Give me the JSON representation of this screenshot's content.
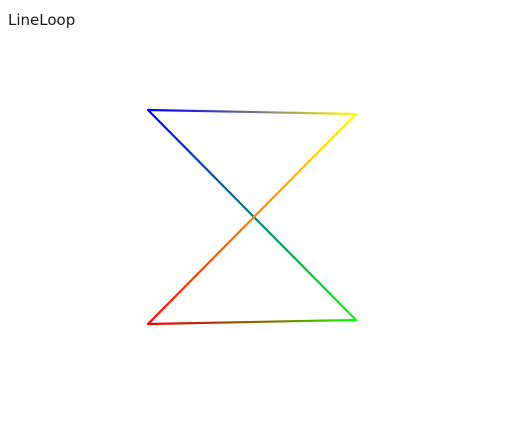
{
  "window": {
    "title": "LineLoop"
  },
  "colors": {
    "background": "#ffffff",
    "title_text": "#1a1a1a",
    "blue": "#0000ff",
    "yellow": "#ffff00",
    "green": "#00ff00",
    "red": "#ff0000",
    "top_mid_1": "#8080a0",
    "top_mid_2": "#c0c040",
    "bottom_mid_1": "#808000",
    "bottom_mid_2": "#60c000"
  }
}
